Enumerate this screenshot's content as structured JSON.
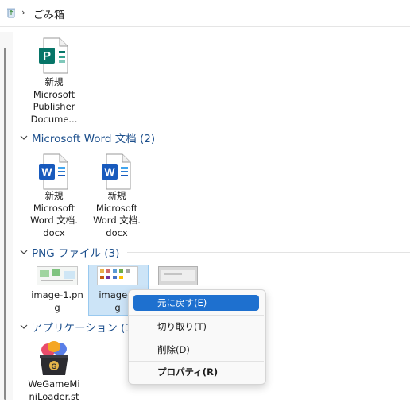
{
  "breadcrumb": {
    "separator": "›",
    "location": "ごみ箱"
  },
  "groups": [
    {
      "title": "Microsoft Word 文档 (2)"
    },
    {
      "title": "PNG ファイル (3)"
    },
    {
      "title": "アプリケーション (1)"
    }
  ],
  "items": {
    "publisher": "新規\nMicrosoft\nPublisher\nDocume...",
    "word1": "新規\nMicrosoft\nWord 文档.\ndocx",
    "word2": "新規\nMicrosoft\nWord 文档.\ndocx",
    "png1": "image-1.pn\ng",
    "png2": "image-2\ng",
    "app": "WeGameMi\nniLoader.st"
  },
  "context_menu": {
    "restore": "元に戻す(E)",
    "cut": "切り取り(T)",
    "delete": "削除(D)",
    "properties": "プロパティ(R)"
  },
  "colors": {
    "group_title": "#1c4f8c",
    "selection": "#cce4f7",
    "menu_highlight": "#1e70cf",
    "publisher_green": "#077568",
    "word_blue": "#185abd"
  }
}
